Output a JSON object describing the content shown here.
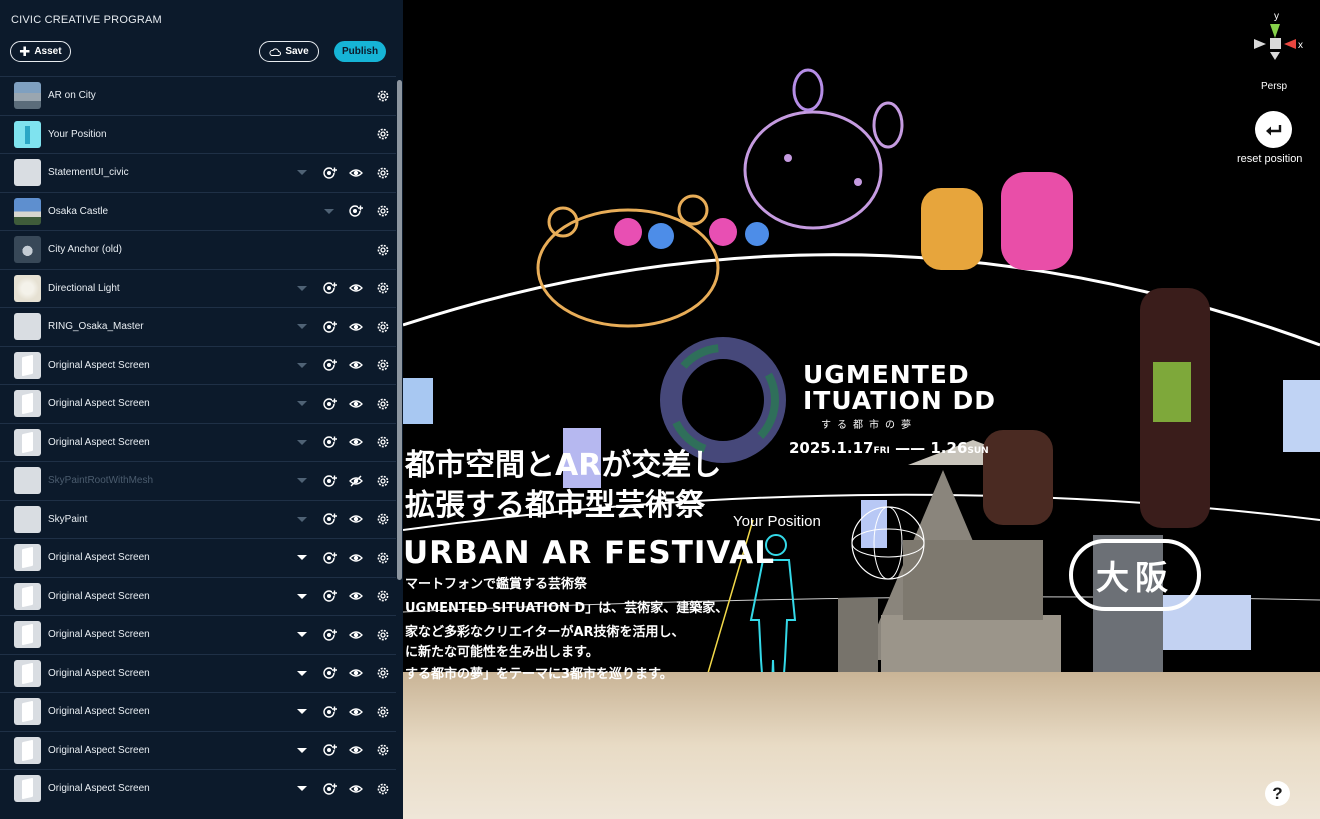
{
  "app": {
    "title": "CIVIC CREATIVE PROGRAM"
  },
  "toolbar": {
    "asset_label": "Asset",
    "save_label": "Save",
    "publish_label": "Publish"
  },
  "assets": [
    {
      "label": "AR on City",
      "thumb": "city",
      "caret": "none",
      "add": false,
      "eye": "none"
    },
    {
      "label": "Your Position",
      "thumb": "pos",
      "caret": "none",
      "add": false,
      "eye": "none"
    },
    {
      "label": "StatementUI_civic",
      "thumb": "blank",
      "caret": "dim",
      "add": true,
      "eye": "on"
    },
    {
      "label": "Osaka Castle",
      "thumb": "castle",
      "caret": "dim",
      "add": true,
      "eye": "none"
    },
    {
      "label": "City Anchor (old)",
      "thumb": "anchor",
      "caret": "none",
      "add": false,
      "eye": "none"
    },
    {
      "label": "Directional Light",
      "thumb": "light",
      "caret": "dim",
      "add": true,
      "eye": "on"
    },
    {
      "label": "RING_Osaka_Master",
      "thumb": "blank",
      "caret": "dim",
      "add": true,
      "eye": "on"
    },
    {
      "label": "Original Aspect Screen",
      "thumb": "screen",
      "caret": "dim",
      "add": true,
      "eye": "on"
    },
    {
      "label": "Original Aspect Screen",
      "thumb": "screen",
      "caret": "dim",
      "add": true,
      "eye": "on"
    },
    {
      "label": "Original Aspect Screen",
      "thumb": "screen",
      "caret": "dim",
      "add": true,
      "eye": "on"
    },
    {
      "label": "SkyPaintRootWithMesh",
      "thumb": "blank",
      "caret": "dim",
      "add": true,
      "eye": "off",
      "dim": true
    },
    {
      "label": "SkyPaint",
      "thumb": "blank",
      "caret": "dim",
      "add": true,
      "eye": "on"
    },
    {
      "label": "Original Aspect Screen",
      "thumb": "screen",
      "caret": "white",
      "add": true,
      "eye": "on"
    },
    {
      "label": "Original Aspect Screen",
      "thumb": "screen",
      "caret": "white",
      "add": true,
      "eye": "on"
    },
    {
      "label": "Original Aspect Screen",
      "thumb": "screen",
      "caret": "white",
      "add": true,
      "eye": "on"
    },
    {
      "label": "Original Aspect Screen",
      "thumb": "screen",
      "caret": "white",
      "add": true,
      "eye": "on"
    },
    {
      "label": "Original Aspect Screen",
      "thumb": "screen",
      "caret": "white",
      "add": true,
      "eye": "on"
    },
    {
      "label": "Original Aspect Screen",
      "thumb": "screen",
      "caret": "white",
      "add": true,
      "eye": "on"
    },
    {
      "label": "Original Aspect Screen",
      "thumb": "screen",
      "caret": "white",
      "add": true,
      "eye": "on"
    }
  ],
  "scene": {
    "jp_line1": "都市空間とARが交差し",
    "jp_line2": "拡張する都市型芸術祭",
    "en_title": "URBAN AR FESTIVAL",
    "desc1": "マートフォンで鑑賞する芸術祭",
    "desc2": "UGMENTED SITUATION D」は、芸術家、建築家、",
    "desc3": "家など多彩なクリエイターがAR技術を活用し、",
    "desc4": "に新たな可能性を生み出します。",
    "desc5": "する都市の夢」をテーマに3都市を巡ります。",
    "brand1": "UGMENTED",
    "brand2": "ITUATION DD",
    "brand_sub": "する都市の夢",
    "date_start": "2025.1.17",
    "date_start_day": "FRI",
    "date_sep": "——",
    "date_end": "1.26",
    "date_end_day": "SUN",
    "your_position": "Your Position",
    "city": "大阪"
  },
  "gizmo": {
    "y": "y",
    "x": "x",
    "mode": "Persp"
  },
  "reset": {
    "label": "reset position"
  },
  "help": {
    "label": "?"
  }
}
